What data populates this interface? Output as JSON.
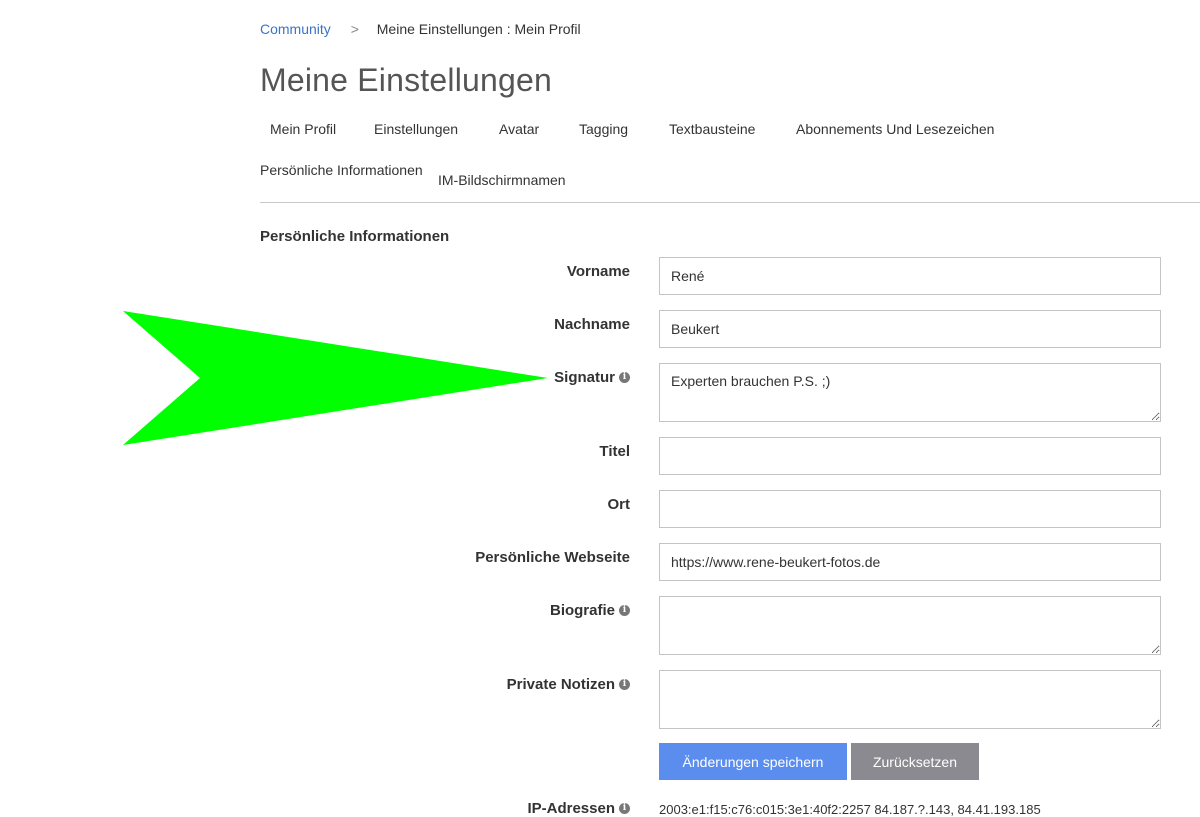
{
  "breadcrumb": {
    "root": "Community",
    "separator": ">",
    "current": "Meine Einstellungen : Mein Profil"
  },
  "page_title": "Meine Einstellungen",
  "tabs": [
    {
      "label": "Mein Profil"
    },
    {
      "label": "Einstellungen"
    },
    {
      "label": "Avatar"
    },
    {
      "label": "Tagging"
    },
    {
      "label": "Textbausteine"
    },
    {
      "label": "Abonnements Und Lesezeichen"
    }
  ],
  "subtabs": [
    {
      "label": "Persönliche Informationen"
    },
    {
      "label": "IM-Bildschirmnamen"
    }
  ],
  "section_title": "Persönliche Informationen",
  "form": {
    "vorname": {
      "label": "Vorname",
      "value": "René"
    },
    "nachname": {
      "label": "Nachname",
      "value": "Beukert"
    },
    "signatur": {
      "label": "Signatur",
      "value": "Experten brauchen P.S. ;)"
    },
    "titel": {
      "label": "Titel",
      "value": ""
    },
    "ort": {
      "label": "Ort",
      "value": ""
    },
    "webseite": {
      "label": "Persönliche Webseite",
      "value": "https://www.rene-beukert-fotos.de"
    },
    "biografie": {
      "label": "Biografie",
      "value": ""
    },
    "notizen": {
      "label": "Private Notizen",
      "value": ""
    }
  },
  "buttons": {
    "save": "Änderungen speichern",
    "reset": "Zurücksetzen"
  },
  "ip": {
    "label": "IP-Adressen",
    "value": "2003:e1:f15:c76:c015:3e1:40f2:2257 84.187.?.143, 84.41.193.185"
  },
  "icons": {
    "info": "info-icon",
    "annotation": "green-arrow-pointer"
  },
  "colors": {
    "link": "#3b73c9",
    "save_button": "#5b8def",
    "reset_button": "#8a8a90",
    "arrow": "#00ff00"
  }
}
